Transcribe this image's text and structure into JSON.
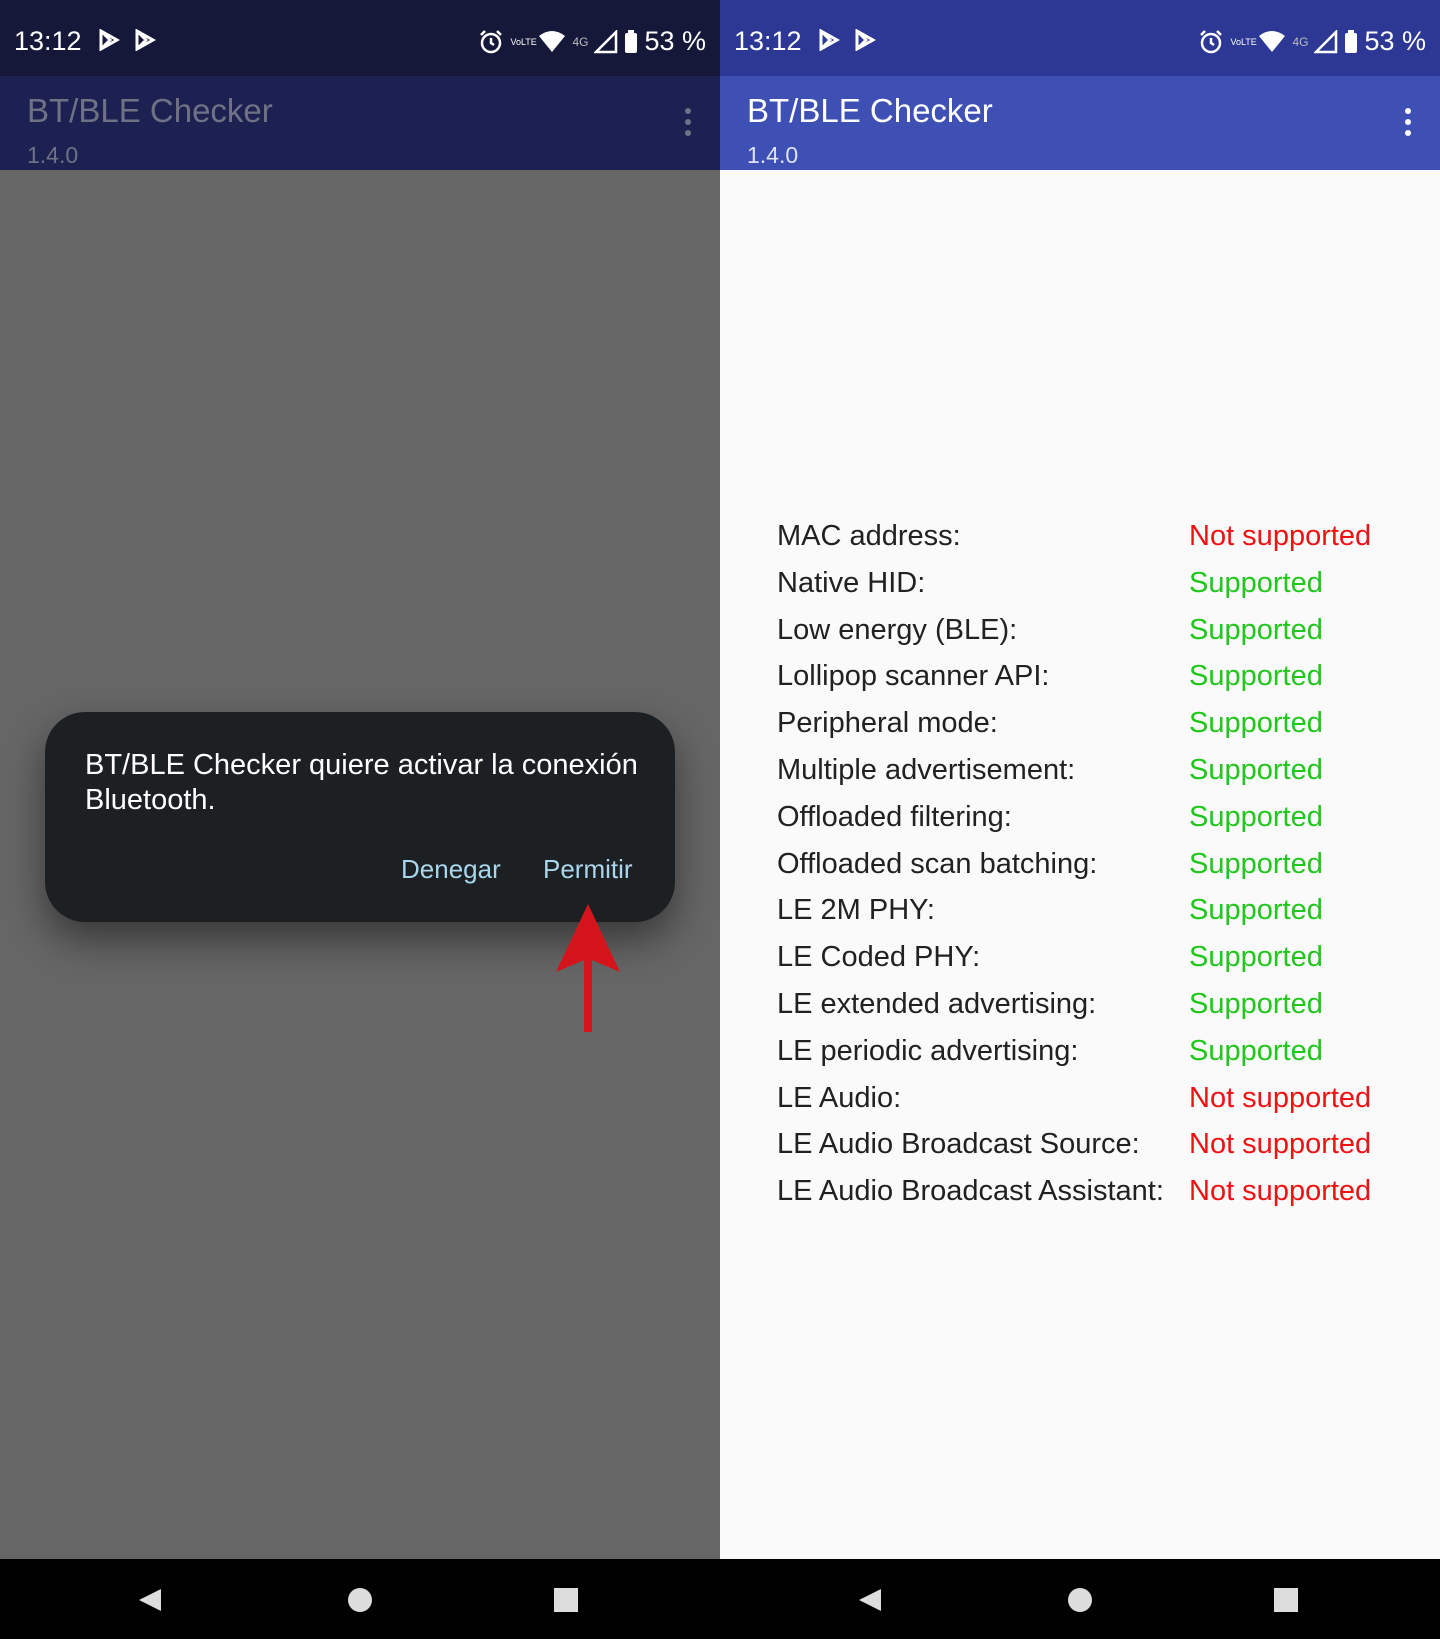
{
  "status_bar": {
    "time": "13:12",
    "network_type": "4G",
    "volte_label": "VoLTE",
    "battery": "53 %"
  },
  "app": {
    "title": "BT/BLE Checker",
    "version": "1.4.0"
  },
  "dialog": {
    "message": "BT/BLE Checker quiere activar la conexión Bluetooth.",
    "deny_label": "Denegar",
    "allow_label": "Permitir"
  },
  "features": [
    {
      "label": "MAC address:",
      "value": "Not supported",
      "supported": false
    },
    {
      "label": "Native HID:",
      "value": "Supported",
      "supported": true
    },
    {
      "label": "Low energy (BLE):",
      "value": "Supported",
      "supported": true
    },
    {
      "label": "Lollipop scanner API:",
      "value": "Supported",
      "supported": true
    },
    {
      "label": "Peripheral mode:",
      "value": "Supported",
      "supported": true
    },
    {
      "label": "Multiple advertisement:",
      "value": "Supported",
      "supported": true
    },
    {
      "label": "Offloaded filtering:",
      "value": "Supported",
      "supported": true
    },
    {
      "label": "Offloaded scan batching:",
      "value": "Supported",
      "supported": true
    },
    {
      "label": "LE 2M PHY:",
      "value": "Supported",
      "supported": true
    },
    {
      "label": "LE Coded PHY:",
      "value": "Supported",
      "supported": true
    },
    {
      "label": "LE extended advertising:",
      "value": "Supported",
      "supported": true
    },
    {
      "label": "LE periodic advertising:",
      "value": "Supported",
      "supported": true
    },
    {
      "label": "LE Audio:",
      "value": "Not supported",
      "supported": false
    },
    {
      "label": "LE Audio Broadcast Source:",
      "value": "Not supported",
      "supported": false
    },
    {
      "label": "LE Audio Broadcast Assistant:",
      "value": "Not supported",
      "supported": false
    }
  ],
  "colors": {
    "supported": "#22c61e",
    "not_supported": "#ee1212",
    "app_bar": "#3e50b4",
    "status_bar": "#2c3894",
    "annotation_arrow": "#d4141a"
  },
  "icons": {
    "status": [
      "play-store-icon",
      "play-store-icon",
      "alarm-icon",
      "volte-icon",
      "wifi-icon",
      "signal-icon",
      "battery-icon"
    ],
    "nav": [
      "back-icon",
      "home-icon",
      "recents-icon"
    ],
    "annotation": "red-arrow-icon"
  }
}
